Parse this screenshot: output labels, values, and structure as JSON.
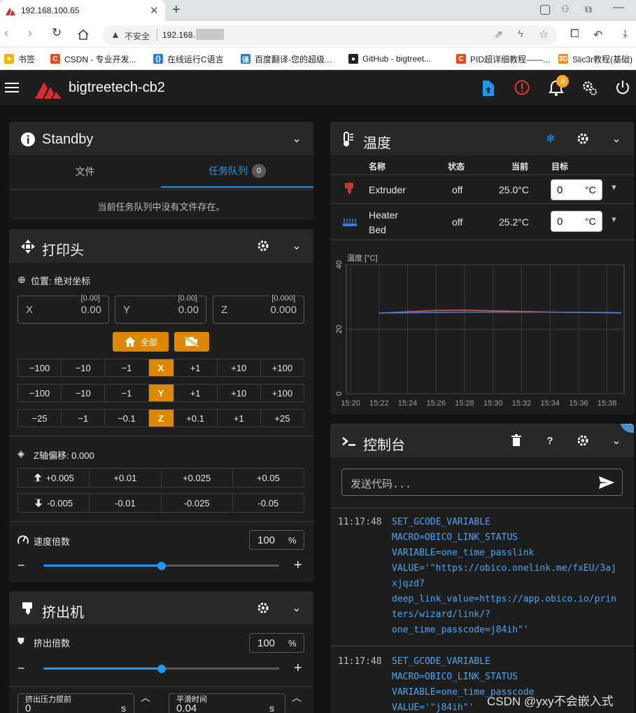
{
  "browser": {
    "tab_title": "192.168.100.65",
    "security_label": "不安全",
    "url": "192.168.",
    "bookmarks": [
      {
        "label": "书签",
        "color": "#f5b400",
        "glyph": "★"
      },
      {
        "label": "CSDN - 专业开发...",
        "color": "#e8491d",
        "glyph": "C"
      },
      {
        "label": "在线运行C语言",
        "color": "#2c7be5",
        "glyph": "{}"
      },
      {
        "label": "百度翻译-您的超级...",
        "color": "#2d7dd2",
        "glyph": "译"
      },
      {
        "label": "GitHub - bigtreet...",
        "color": "#222222",
        "glyph": "●"
      },
      {
        "label": "PID超详细教程——...",
        "color": "#e8491d",
        "glyph": "C"
      },
      {
        "label": "Slic3r教程(基础)",
        "color": "#f58b1f",
        "glyph": "3D"
      }
    ]
  },
  "app": {
    "title": "bigtreetech-cb2",
    "notification_count": "3",
    "accent": "#dd8800",
    "brand_red": "#d32f2f"
  },
  "status_panel": {
    "title": "Standby",
    "tabs": [
      {
        "label": "文件"
      },
      {
        "label": "任务队列",
        "badge": "0"
      }
    ],
    "empty_message": "当前任务队列中没有文件存在。"
  },
  "toolhead": {
    "title": "打印头",
    "position_label": "位置: 绝对坐标",
    "axes": [
      {
        "label": "X",
        "value": "0.00",
        "commanded": "[0.00]"
      },
      {
        "label": "Y",
        "value": "0.00",
        "commanded": "[0.00]"
      },
      {
        "label": "Z",
        "value": "0.000",
        "commanded": "[0.000]"
      }
    ],
    "home_all_label": "全部",
    "move_rows": [
      {
        "axis": "X",
        "neg": [
          "−100",
          "−10",
          "−1"
        ],
        "pos": [
          "+1",
          "+10",
          "+100"
        ]
      },
      {
        "axis": "Y",
        "neg": [
          "−100",
          "−10",
          "−1"
        ],
        "pos": [
          "+1",
          "+10",
          "+100"
        ]
      },
      {
        "axis": "Z",
        "neg": [
          "−25",
          "−1",
          "−0.1"
        ],
        "pos": [
          "+0.1",
          "+1",
          "+25"
        ]
      }
    ],
    "z_offset_label": "Z轴偏移: 0.000",
    "z_offset_up": [
      "+0.005",
      "+0.01",
      "+0.025",
      "+0.05"
    ],
    "z_offset_down": [
      "-0.005",
      "-0.01",
      "-0.025",
      "-0.05"
    ],
    "speed_label": "速度倍数",
    "speed_value": "100",
    "speed_unit": "%",
    "speed_slider_fraction": 0.5
  },
  "extruder_panel": {
    "title": "挤出机",
    "flow_label": "挤出倍数",
    "flow_value": "100",
    "flow_unit": "%",
    "flow_slider_fraction": 0.5,
    "pressure_advance_label": "挤出压力提前",
    "pressure_advance_value": "0",
    "pressure_advance_unit": "s",
    "smooth_time_label": "平滑时间",
    "smooth_time_value": "0.04",
    "smooth_time_unit": "s"
  },
  "temperature": {
    "title": "温度",
    "columns": [
      "名称",
      "状态",
      "当前",
      "目标"
    ],
    "heaters": [
      {
        "name": "Extruder",
        "state": "off",
        "current": "25.0°C",
        "target": "0",
        "unit": "°C",
        "color": "#d9534f"
      },
      {
        "name": "Heater Bed",
        "state": "off",
        "current": "25.2°C",
        "target": "0",
        "unit": "°C",
        "color": "#3b7dd8"
      }
    ]
  },
  "chart_data": {
    "type": "line",
    "ylabel": "温度 [°C]",
    "ylim": [
      0,
      40
    ],
    "y_ticks": [
      "0",
      "20",
      "40"
    ],
    "x_ticks": [
      "15:20",
      "15:22",
      "15:24",
      "15:26",
      "15:28",
      "15:30",
      "15:32",
      "15:34",
      "15:36",
      "15:38"
    ],
    "x": [
      "15:22",
      "15:24",
      "15:26",
      "15:28",
      "15:30",
      "15:32",
      "15:34",
      "15:36",
      "15:38",
      "15:39"
    ],
    "series": [
      {
        "name": "Extruder",
        "color": "#d9534f",
        "values": [
          25.0,
          25.4,
          25.8,
          25.9,
          25.7,
          25.5,
          25.3,
          25.2,
          25.1,
          25.0
        ]
      },
      {
        "name": "Heater Bed",
        "color": "#3b7dd8",
        "values": [
          25.0,
          25.1,
          25.2,
          25.3,
          25.3,
          25.3,
          25.3,
          25.2,
          25.2,
          25.1
        ]
      }
    ],
    "grid": true
  },
  "console": {
    "title": "控制台",
    "placeholder": "发送代码...",
    "entries": [
      {
        "time": "11:17:48",
        "lines": [
          "SET_GCODE_VARIABLE",
          "MACRO=OBICO_LINK_STATUS",
          "VARIABLE=one_time_passlink",
          "VALUE='\"https://obico.onelink.me/fxEU/3aj",
          "xjqzd?",
          "deep_link_value=https://app.obico.io/prin",
          "ters/wizard/link/?",
          "one_time_passcode=j84ih\"'"
        ]
      },
      {
        "time": "11:17:48",
        "lines": [
          "SET_GCODE_VARIABLE",
          "MACRO=OBICO_LINK_STATUS",
          "VARIABLE=one_time_passcode",
          "VALUE='\"j84ih\"'"
        ]
      }
    ]
  },
  "watermark": "CSDN @yxy不会嵌入式"
}
